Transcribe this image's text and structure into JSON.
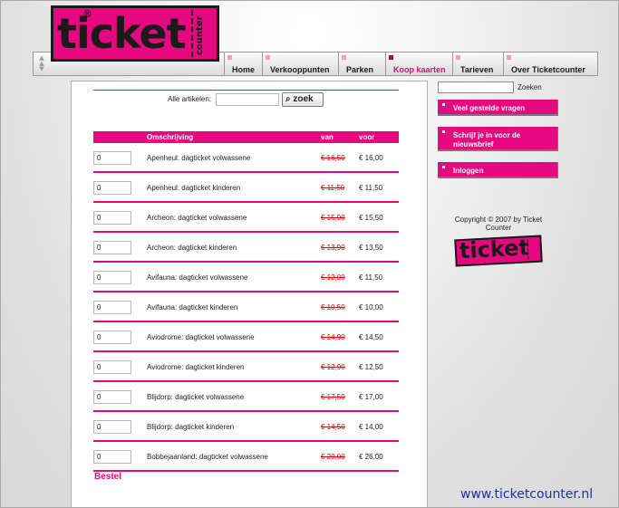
{
  "logo": {
    "word": "ticket",
    "reg": "®",
    "side": "counter"
  },
  "nav": {
    "items": [
      {
        "label": "Home"
      },
      {
        "label": "Verkooppunten"
      },
      {
        "label": "Parken"
      },
      {
        "label": "Koop kaarten",
        "active": true
      },
      {
        "label": "Tarieven"
      },
      {
        "label": "Over Ticketcounter"
      }
    ]
  },
  "search": {
    "label": "Alle artikelen:",
    "value": "",
    "button": "zoek"
  },
  "table": {
    "headers": {
      "description": "Omschrijving",
      "from": "van",
      "to": "voor"
    },
    "rows": [
      {
        "qty": "0",
        "description": "Apenheul: dagticket volwassene",
        "old": "€ 16,50",
        "new": "€ 16,00"
      },
      {
        "qty": "0",
        "description": "Apenheul: dagticket kinderen",
        "old": "€ 11,50",
        "new": "€ 11,50"
      },
      {
        "qty": "0",
        "description": "Archeon: dagticket volwassene",
        "old": "€ 15,90",
        "new": "€ 15,50"
      },
      {
        "qty": "0",
        "description": "Archeon: dagticket kinderen",
        "old": "€ 13,90",
        "new": "€ 13,50"
      },
      {
        "qty": "0",
        "description": "Avifauna: dagticket volwassene",
        "old": "€ 12,00",
        "new": "€ 11,50"
      },
      {
        "qty": "0",
        "description": "Avifauna: dagticket kinderen",
        "old": "€ 10,50",
        "new": "€ 10,00"
      },
      {
        "qty": "0",
        "description": "Aviodrome: dagticket volwassene",
        "old": "€ 14,90",
        "new": "€ 14,50"
      },
      {
        "qty": "0",
        "description": "Aviodrome: dagticket kinderen",
        "old": "€ 12,90",
        "new": "€ 12,50"
      },
      {
        "qty": "0",
        "description": "Blijdorp: dagticket volwassene",
        "old": "€ 17,50",
        "new": "€ 17,00"
      },
      {
        "qty": "0",
        "description": "Blijdorp: dagticket kinderen",
        "old": "€ 14,50",
        "new": "€ 14,00"
      },
      {
        "qty": "0",
        "description": "Bobbejaanland: dagticket volwassene",
        "old": "€ 29,00",
        "new": "€ 26,00"
      }
    ],
    "order_label": "Bestel"
  },
  "sidebar": {
    "search_label": "Zoeken",
    "search_value": "",
    "buttons": [
      {
        "label": "Veel gestelde vragen"
      },
      {
        "label": "Schrijf je in voor de nieuwsbrief"
      },
      {
        "label": "Inloggen"
      }
    ],
    "copyright": "Copyright © 2007 by Ticket Counter"
  },
  "minilogo": {
    "word": "ticket"
  },
  "footer_url": "www.ticketcounter.nl",
  "colors": {
    "accent": "#e5087f",
    "strike": "#e00000",
    "link": "#1a33a8"
  }
}
